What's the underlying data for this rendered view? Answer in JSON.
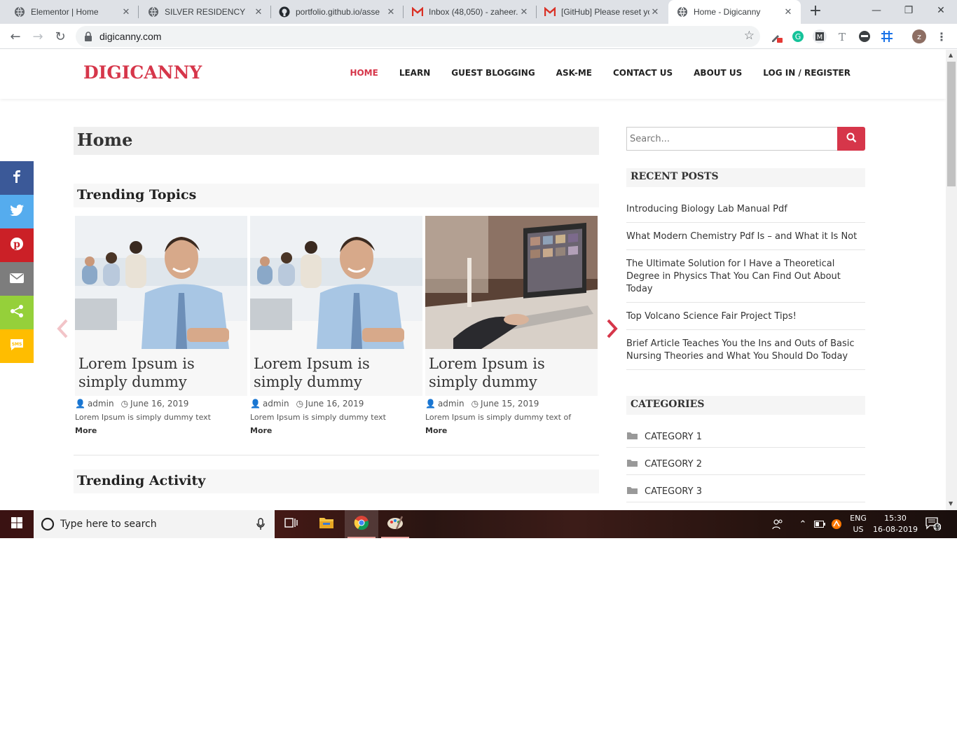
{
  "browser": {
    "tabs": [
      {
        "title": "Elementor | Home",
        "icon": "globe-icon",
        "active": false
      },
      {
        "title": "SILVER RESIDENCY",
        "icon": "globe-icon",
        "active": false
      },
      {
        "title": "portfolio.github.io/asse",
        "icon": "github-icon",
        "active": false
      },
      {
        "title": "Inbox (48,050) - zaheer.",
        "icon": "gmail-icon",
        "active": false
      },
      {
        "title": "[GitHub] Please reset yo",
        "icon": "gmail-icon",
        "active": false
      },
      {
        "title": "Home - Digicanny",
        "icon": "globe-icon",
        "active": true
      }
    ],
    "url": "digicanny.com",
    "profile_initial": "z"
  },
  "site": {
    "logo": "DIGICANNY",
    "nav": [
      "HOME",
      "LEARN",
      "GUEST BLOGGING",
      "ASK-ME",
      "CONTACT US",
      "ABOUT US",
      "LOG IN / REGISTER"
    ],
    "page_title": "Home",
    "trending_topics_title": "Trending Topics",
    "trending_activity_title": "Trending Activity",
    "cards": [
      {
        "title": "Lorem Ipsum is simply dummy",
        "author": "admin",
        "date": "June 16, 2019",
        "excerpt": "Lorem Ipsum is simply dummy text",
        "more": "More",
        "image": "office-man-photo"
      },
      {
        "title": "Lorem Ipsum is simply dummy",
        "author": "admin",
        "date": "June 16, 2019",
        "excerpt": "Lorem Ipsum is simply dummy text",
        "more": "More",
        "image": "office-man-photo"
      },
      {
        "title": "Lorem Ipsum is simply dummy",
        "author": "admin",
        "date": "June 15, 2019",
        "excerpt": "Lorem Ipsum is simply dummy text of",
        "more": "More",
        "image": "laptop-photo"
      }
    ],
    "search_placeholder": "Search...",
    "recent_posts_title": "RECENT POSTS",
    "recent_posts": [
      "Introducing Biology Lab Manual Pdf",
      "What Modern Chemistry Pdf Is – and What it Is Not",
      "The Ultimate Solution for I Have a Theoretical Degree in Physics That You Can Find Out About Today",
      "Top Volcano Science Fair Project Tips!",
      "Brief Article Teaches You the Ins and Outs of Basic Nursing Theories and What You Should Do Today"
    ],
    "categories_title": "CATEGORIES",
    "categories": [
      "CATEGORY 1",
      "CATEGORY 2",
      "CATEGORY 3"
    ],
    "share_buttons": [
      {
        "name": "facebook",
        "color": "#3b5998"
      },
      {
        "name": "twitter",
        "color": "#55acee"
      },
      {
        "name": "pinterest",
        "color": "#cb2027"
      },
      {
        "name": "email",
        "color": "#7d7d7d"
      },
      {
        "name": "share",
        "color": "#95d03a"
      },
      {
        "name": "sms",
        "color": "#ffbd00"
      }
    ],
    "colors": {
      "accent": "#d6364a"
    }
  },
  "taskbar": {
    "search_placeholder": "Type here to search",
    "lang_top": "ENG",
    "lang_bottom": "US",
    "time": "15:30",
    "date": "16-08-2019",
    "notification_count": "19"
  }
}
